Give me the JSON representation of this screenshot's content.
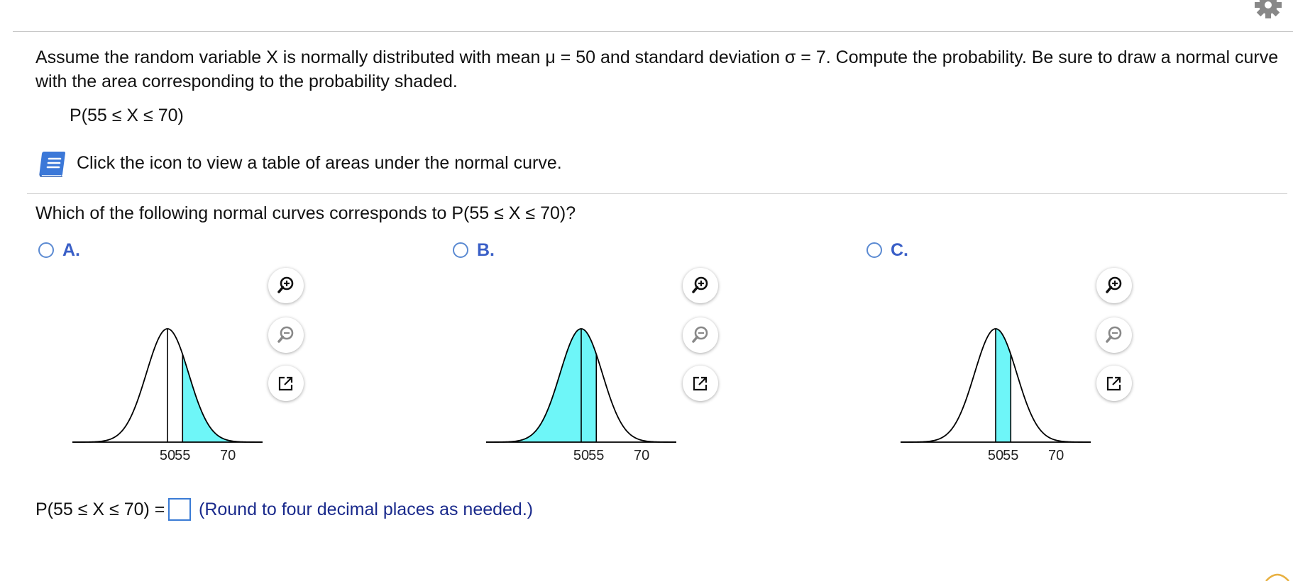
{
  "problem": {
    "statement": "Assume the random variable X is normally distributed with mean μ = 50 and standard deviation σ = 7. Compute the probability. Be sure to draw a normal curve with the area corresponding to the probability shaded.",
    "expression": "P(55 ≤ X ≤ 70)"
  },
  "resources": {
    "table_link_text": "Click the icon to view a table of areas under the normal curve."
  },
  "question": {
    "text": "Which of the following normal curves corresponds to P(55 ≤ X ≤ 70)?"
  },
  "choices": [
    {
      "letter": "A.",
      "ticks": [
        "50",
        "55",
        "70"
      ],
      "shaded_from": 55,
      "shaded_to": "inf"
    },
    {
      "letter": "B.",
      "ticks": [
        "50",
        "55",
        "70"
      ],
      "shaded_from": "-inf",
      "shaded_to": 55
    },
    {
      "letter": "C.",
      "ticks": [
        "50",
        "55",
        "70"
      ],
      "shaded_from": 50,
      "shaded_to": 55
    }
  ],
  "graph_tools": [
    "zoom-in-icon",
    "zoom-out-icon",
    "popout-icon"
  ],
  "answer": {
    "label": "P(55 ≤ X ≤ 70) =",
    "value": "",
    "hint": "(Round to four decimal places as needed.)"
  },
  "colors": {
    "shade": "#6ef6f8",
    "choice_letter": "#3a5fc7",
    "hint": "#1a2a8c",
    "input_border": "#3a7bd5"
  }
}
